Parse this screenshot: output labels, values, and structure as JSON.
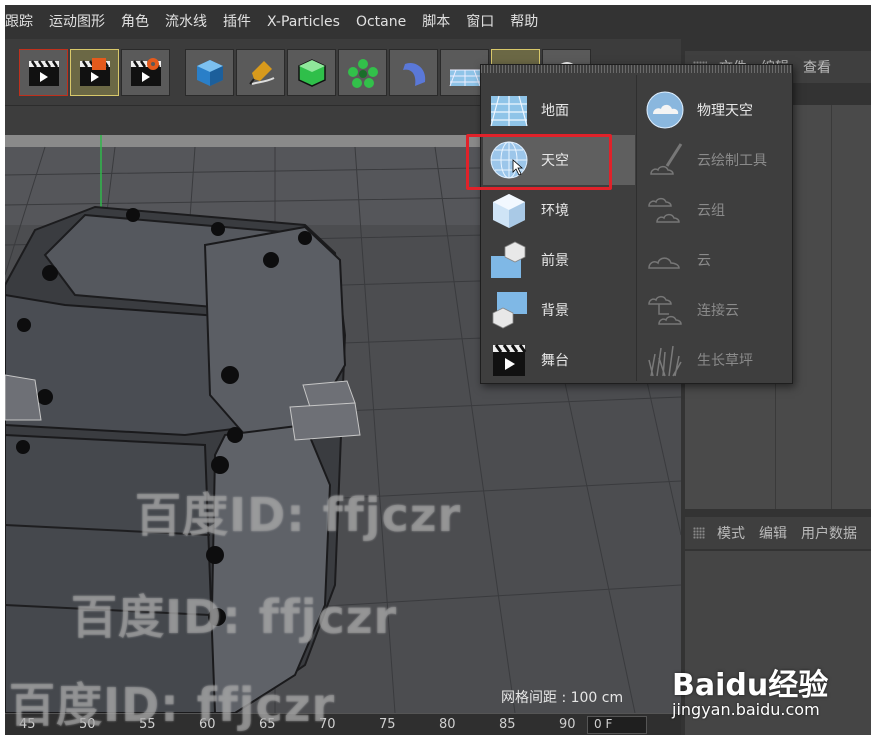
{
  "menubar": {
    "items": [
      "跟踪",
      "运动图形",
      "角色",
      "流水线",
      "插件",
      "X-Particles",
      "Octane",
      "脚本",
      "窗口",
      "帮助"
    ]
  },
  "toolbar": {
    "buttons": [
      "clapper-icon",
      "clapper-edit-icon",
      "clapper-settings-icon",
      "cube-icon",
      "pen-icon",
      "subdivision-cube-icon",
      "flower-array-icon",
      "deformer-icon",
      "floor-icon",
      "camera-icon",
      "light-icon"
    ]
  },
  "right_panel_top": {
    "tabs": [
      "文件",
      "编辑",
      "查看"
    ]
  },
  "right_panel_bottom": {
    "tabs": [
      "模式",
      "编辑",
      "用户数据"
    ]
  },
  "popup": {
    "left_items": [
      {
        "label": "地面",
        "icon": "floor-icon"
      },
      {
        "label": "天空",
        "icon": "sky-icon",
        "selected": true
      },
      {
        "label": "环境",
        "icon": "environment-icon"
      },
      {
        "label": "前景",
        "icon": "foreground-icon"
      },
      {
        "label": "背景",
        "icon": "background-icon"
      },
      {
        "label": "舞台",
        "icon": "stage-icon"
      }
    ],
    "right_items": [
      {
        "label": "物理天空",
        "icon": "physical-sky-icon",
        "enabled": true
      },
      {
        "label": "云绘制工具",
        "icon": "cloud-brush-icon",
        "enabled": false
      },
      {
        "label": "云组",
        "icon": "cloud-group-icon",
        "enabled": false
      },
      {
        "label": "云",
        "icon": "cloud-icon",
        "enabled": false
      },
      {
        "label": "连接云",
        "icon": "connect-cloud-icon",
        "enabled": false
      },
      {
        "label": "生长草坪",
        "icon": "grass-icon",
        "enabled": false
      }
    ]
  },
  "viewport": {
    "grid_spacing": "网格间距 : 100 cm"
  },
  "ruler": {
    "ticks": [
      "45",
      "50",
      "55",
      "60",
      "65",
      "70",
      "75",
      "80",
      "85",
      "90"
    ],
    "field_value": "0 F"
  },
  "watermark": {
    "text": "百度ID: ffjczr"
  },
  "baidu": {
    "logo_text": "Baidu经验",
    "url": "jingyan.baidu.com"
  },
  "colors": {
    "highlight_border": "#e0222a",
    "toolbar_highlight": "#d8c86a"
  }
}
